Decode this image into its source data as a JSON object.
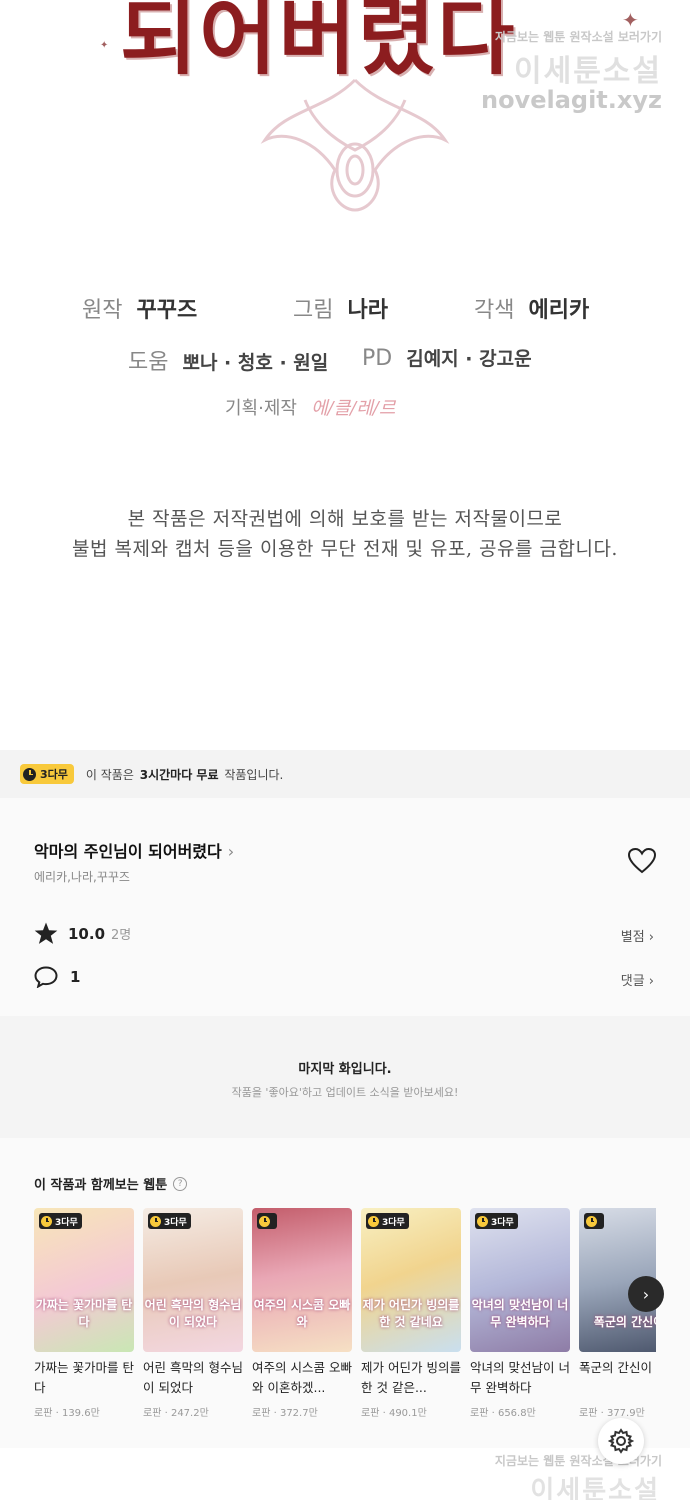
{
  "comic": {
    "title_art": "되어버렸다",
    "watermark_small": "지금보는 웹툰 원작소설 보러가기",
    "watermark_big": "이세툰소설",
    "watermark_url": "novelagit.xyz",
    "credits": {
      "story_label": "원작",
      "story_value": "꾸꾸즈",
      "art_label": "그림",
      "art_value": "나라",
      "color_label": "각색",
      "color_value": "에리카",
      "assist_label": "도움",
      "assist_value": "뽀나 · 청호 · 원일",
      "pd_label": "PD",
      "pd_value": "김예지 · 강고운",
      "production_label": "기획·제작",
      "production_value": "에/클/레/르"
    },
    "notice_line1": "본 작품은 저작권법에 의해 보호를 받는 저작물이므로",
    "notice_line2": "불법 복제와 캡처 등을 이용한 무단 전재 및 유포, 공유를 금합니다."
  },
  "free_bar": {
    "badge": "3다무",
    "text_pre": "이 작품은",
    "text_bold": "3시간마다 무료",
    "text_post": "작품입니다."
  },
  "work": {
    "title": "악마의 주인님이 되어버렸다",
    "authors": "에리카,나라,꾸꾸즈",
    "rating": "10.0",
    "rating_count": "2명",
    "rating_link": "별점",
    "comment_count": "1",
    "comment_link": "댓글"
  },
  "last_episode": {
    "title": "마지막 화입니다.",
    "subtitle": "작품을 '좋아요'하고 업데이트 소식을 받아보세요!"
  },
  "recommendations": {
    "heading": "이 작품과 함께보는 웹툰",
    "items": [
      {
        "badge": "3다무",
        "title": "가짜는 꽃가마를 탄다",
        "genre": "로판",
        "views": "139.6만",
        "art": "가짜는 꽃가마를 탄다"
      },
      {
        "badge": "3다무",
        "title": "어린 흑막의 형수님이 되었다",
        "genre": "로판",
        "views": "247.2만",
        "art": "어린 흑막의 형수님이 되었다"
      },
      {
        "badge": "",
        "title": "여주의 시스콤 오빠와 이혼하겠...",
        "genre": "로판",
        "views": "372.7만",
        "art": "여주의 시스콤 오빠와"
      },
      {
        "badge": "3다무",
        "title": "제가 어딘가 빙의를 한 것 같은...",
        "genre": "로판",
        "views": "490.1만",
        "art": "제가 어딘가 빙의를 한 것 같네요"
      },
      {
        "badge": "3다무",
        "title": "악녀의 맞선남이 너무 완벽하다",
        "genre": "로판",
        "views": "656.8만",
        "art": "악녀의 맞선남이 너무 완벽하다"
      },
      {
        "badge": "",
        "title": "폭군의 간신이 있다",
        "genre": "로판",
        "views": "377.9만",
        "art": "폭군의 간신이"
      }
    ]
  },
  "colors": {
    "badge_yellow": "#f8c93b",
    "title_red": "#8c1d1f"
  },
  "icons": [
    "clock-icon",
    "chevron-right-icon",
    "heart-icon",
    "star-icon",
    "speech-bubble-icon",
    "question-icon",
    "arrow-right-icon",
    "gear-icon"
  ]
}
